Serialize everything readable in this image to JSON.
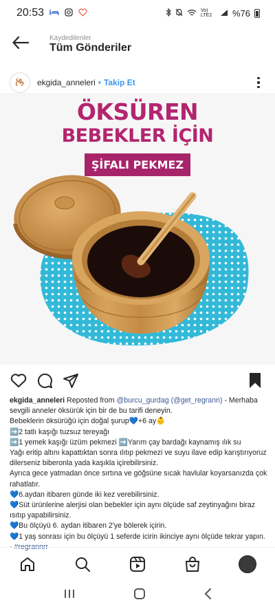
{
  "status_bar": {
    "time": "20:53",
    "battery": "%76",
    "network": "Vo) LTE2"
  },
  "header": {
    "subtitle": "Kaydedilenler",
    "title": "Tüm Gönderiler"
  },
  "post": {
    "username": "ekgida_anneleri",
    "separator": "•",
    "follow_label": "Takip Et",
    "image": {
      "title_line1": "ÖKSÜREN",
      "title_line2": "BEBEKLER İÇİN",
      "title_badge": "ŞİFALI PEKMEZ"
    },
    "caption": {
      "username": "ekgida_anneleri",
      "reposted": " Reposted from ",
      "mention1": "@burcu_gurdag",
      "mention2": "(@get_regrann)",
      "intro": " -  Merhaba sevgili anneler öksürük için bir de bu tarifi deneyin.",
      "line1": "Bebeklerin öksürüğü için doğal şurup💙+6 ay👶",
      "line2": "➡️2 tatlı kaşığı tuzsuz tereyağı",
      "line3": "➡️1 yemek kaşığı üzüm pekmezi ➡️Yarım çay bardağı kaynamış ılık su",
      "line4": "Yağı eritip altını kapattıktan sonra ılıtıp pekmezi ve suyu ilave edip karıştırıyoruz dilerseniz biberonla yada kaşıkla içirebilirsiniz.",
      "line5": "Ayrıca gece yatmadan önce sırtına ve göğsüne sıcak havlular koyarsanızda çok rahatlatır.",
      "line6": "💙6.aydan itibaren günde iki kez verebilirsiniz.",
      "line7": "💙Süt ürünlerine alerjisi olan bebekler için aynı ölçüde saf zeytinyağını biraz ısıtıp yapabilirsiniz.",
      "line8": "💙Bu ölçüyü 6. aydan itibaren 2'ye bölerek içirin.",
      "line9": "💙1 yaş sonrası için bu ölçüyü 1 seferde icirin ikinciye aynı ölçüde tekrar yapın.",
      "hashtag": "- #regrannrr"
    }
  },
  "colors": {
    "accent": "#3897f0",
    "title_pink": "#b3256f",
    "badge": "#a8246a"
  }
}
